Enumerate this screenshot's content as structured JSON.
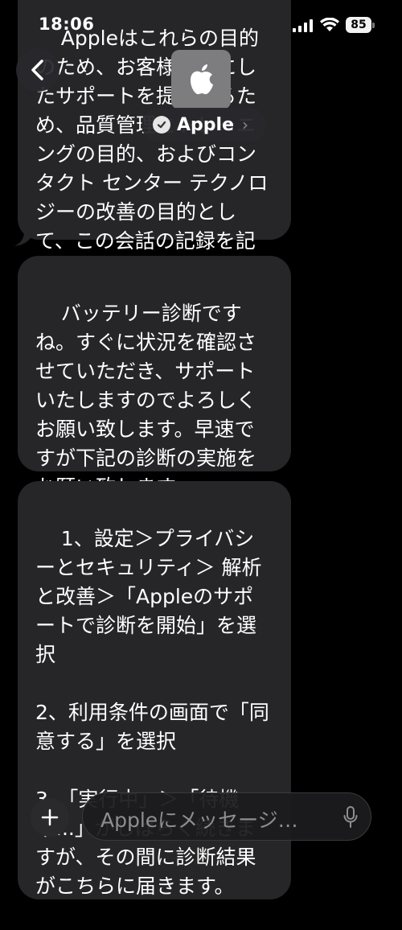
{
  "status_bar": {
    "time": "18:06",
    "battery": "85"
  },
  "header": {
    "contact_name": "Apple",
    "chevron": "›"
  },
  "messages": [
    {
      "text": "Appleはこれらの目的のため、お客様へ更にしたサポートを提供するため、品質管理とトレーニングの目的、およびコンタクト センター テクノロジーの改善の目的として、この会話の記録を記録、使用、および保存することがあります。"
    },
    {
      "text": "バッテリー診断ですね。すぐに状況を確認させていただき、サポートいたしますのでよろしくお願い致します。早速ですが下記の診断の実施をお願い致します。"
    },
    {
      "text": "1、設定＞プライバシーとセキュリティ＞ 解析と改善＞「Appleのサポートで診断を開始」を選択\n\n2、利用条件の画面で「同意する」を選択\n\n3、「実行中」＞「待機中...」がしばらく続きますが、その間に診断結果がこちらに届きます。"
    }
  ],
  "input": {
    "placeholder": "Appleにメッセージ…"
  },
  "icons": {
    "back": "chevron-left-icon",
    "avatar": "apple-logo-icon",
    "verified": "verified-badge-icon",
    "add": "plus-icon",
    "mic": "microphone-icon"
  },
  "colors": {
    "bubble": "#262628",
    "background": "#000000",
    "placeholder": "#8e8e93"
  }
}
